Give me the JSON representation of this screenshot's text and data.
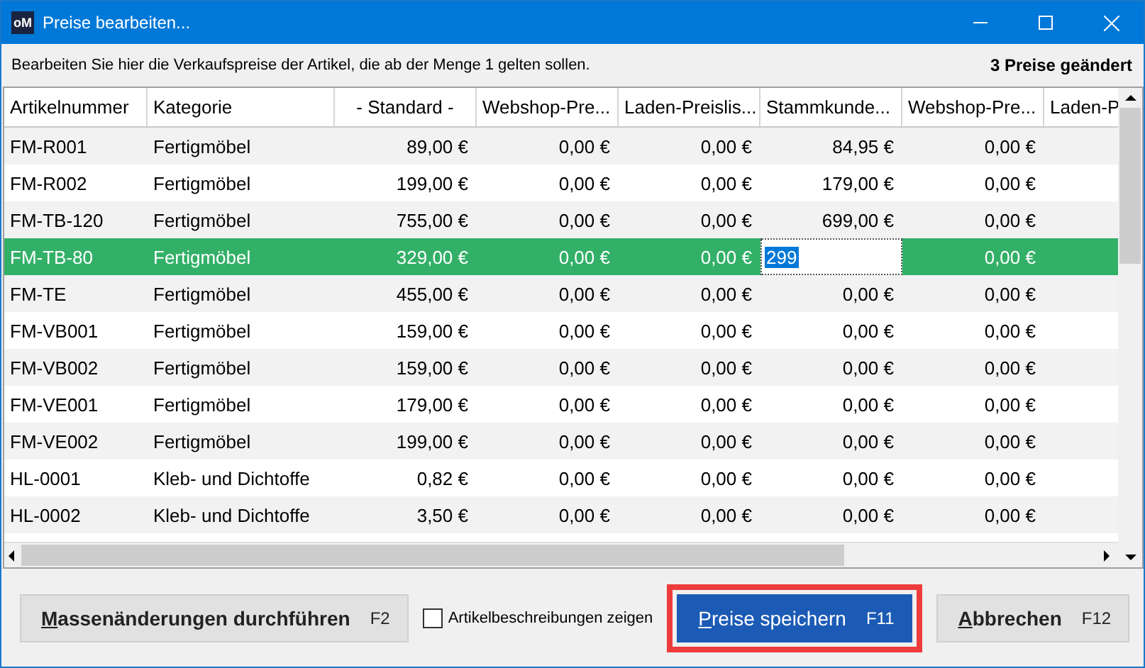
{
  "window": {
    "app_icon": "oM",
    "title": "Preise bearbeiten..."
  },
  "info": {
    "text": "Bearbeiten Sie hier die Verkaufspreise der Artikel, die ab der Menge 1 gelten sollen.",
    "status": "3 Preise geändert"
  },
  "table": {
    "columns": [
      "Artikelnummer",
      "Kategorie",
      "- Standard -",
      "Webshop-Pre...",
      "Laden-Preislis...",
      "Stammkunde...",
      "Webshop-Pre...",
      "Laden-P"
    ],
    "rows": [
      {
        "selected": false,
        "cells": [
          "FM-R001",
          "Fertigmöbel",
          "89,00 €",
          "0,00 €",
          "0,00 €",
          "84,95 €",
          "0,00 €"
        ]
      },
      {
        "selected": false,
        "cells": [
          "FM-R002",
          "Fertigmöbel",
          "199,00 €",
          "0,00 €",
          "0,00 €",
          "179,00 €",
          "0,00 €"
        ]
      },
      {
        "selected": false,
        "cells": [
          "FM-TB-120",
          "Fertigmöbel",
          "755,00 €",
          "0,00 €",
          "0,00 €",
          "699,00 €",
          "0,00 €"
        ]
      },
      {
        "selected": true,
        "cells": [
          "FM-TB-80",
          "Fertigmöbel",
          "329,00 €",
          "0,00 €",
          "0,00 €",
          {
            "value": "299",
            "editing": true
          },
          "0,00 €"
        ]
      },
      {
        "selected": false,
        "cells": [
          "FM-TE",
          "Fertigmöbel",
          "455,00 €",
          "0,00 €",
          "0,00 €",
          "0,00 €",
          "0,00 €"
        ]
      },
      {
        "selected": false,
        "cells": [
          "FM-VB001",
          "Fertigmöbel",
          "159,00 €",
          "0,00 €",
          "0,00 €",
          "0,00 €",
          "0,00 €"
        ]
      },
      {
        "selected": false,
        "cells": [
          "FM-VB002",
          "Fertigmöbel",
          "159,00 €",
          "0,00 €",
          "0,00 €",
          "0,00 €",
          "0,00 €"
        ]
      },
      {
        "selected": false,
        "cells": [
          "FM-VE001",
          "Fertigmöbel",
          "179,00 €",
          "0,00 €",
          "0,00 €",
          "0,00 €",
          "0,00 €"
        ]
      },
      {
        "selected": false,
        "cells": [
          "FM-VE002",
          "Fertigmöbel",
          "199,00 €",
          "0,00 €",
          "0,00 €",
          "0,00 €",
          "0,00 €"
        ]
      },
      {
        "selected": false,
        "cells": [
          "HL-0001",
          "Kleb- und Dichtoffe",
          "0,82 €",
          "0,00 €",
          "0,00 €",
          "0,00 €",
          "0,00 €"
        ]
      },
      {
        "selected": false,
        "cells": [
          "HL-0002",
          "Kleb- und Dichtoffe",
          "3,50 €",
          "0,00 €",
          "0,00 €",
          "0,00 €",
          "0,00 €"
        ]
      }
    ]
  },
  "footer": {
    "mass_button": {
      "label": "Massenänderungen durchführen",
      "shortcut": "F2"
    },
    "checkbox": {
      "label": "Artikelbeschreibungen zeigen",
      "checked": false
    },
    "save_button": {
      "label": "Preise speichern",
      "shortcut": "F11",
      "highlighted": true
    },
    "cancel_button": {
      "label": "Abbrechen",
      "shortcut": "F12"
    }
  }
}
